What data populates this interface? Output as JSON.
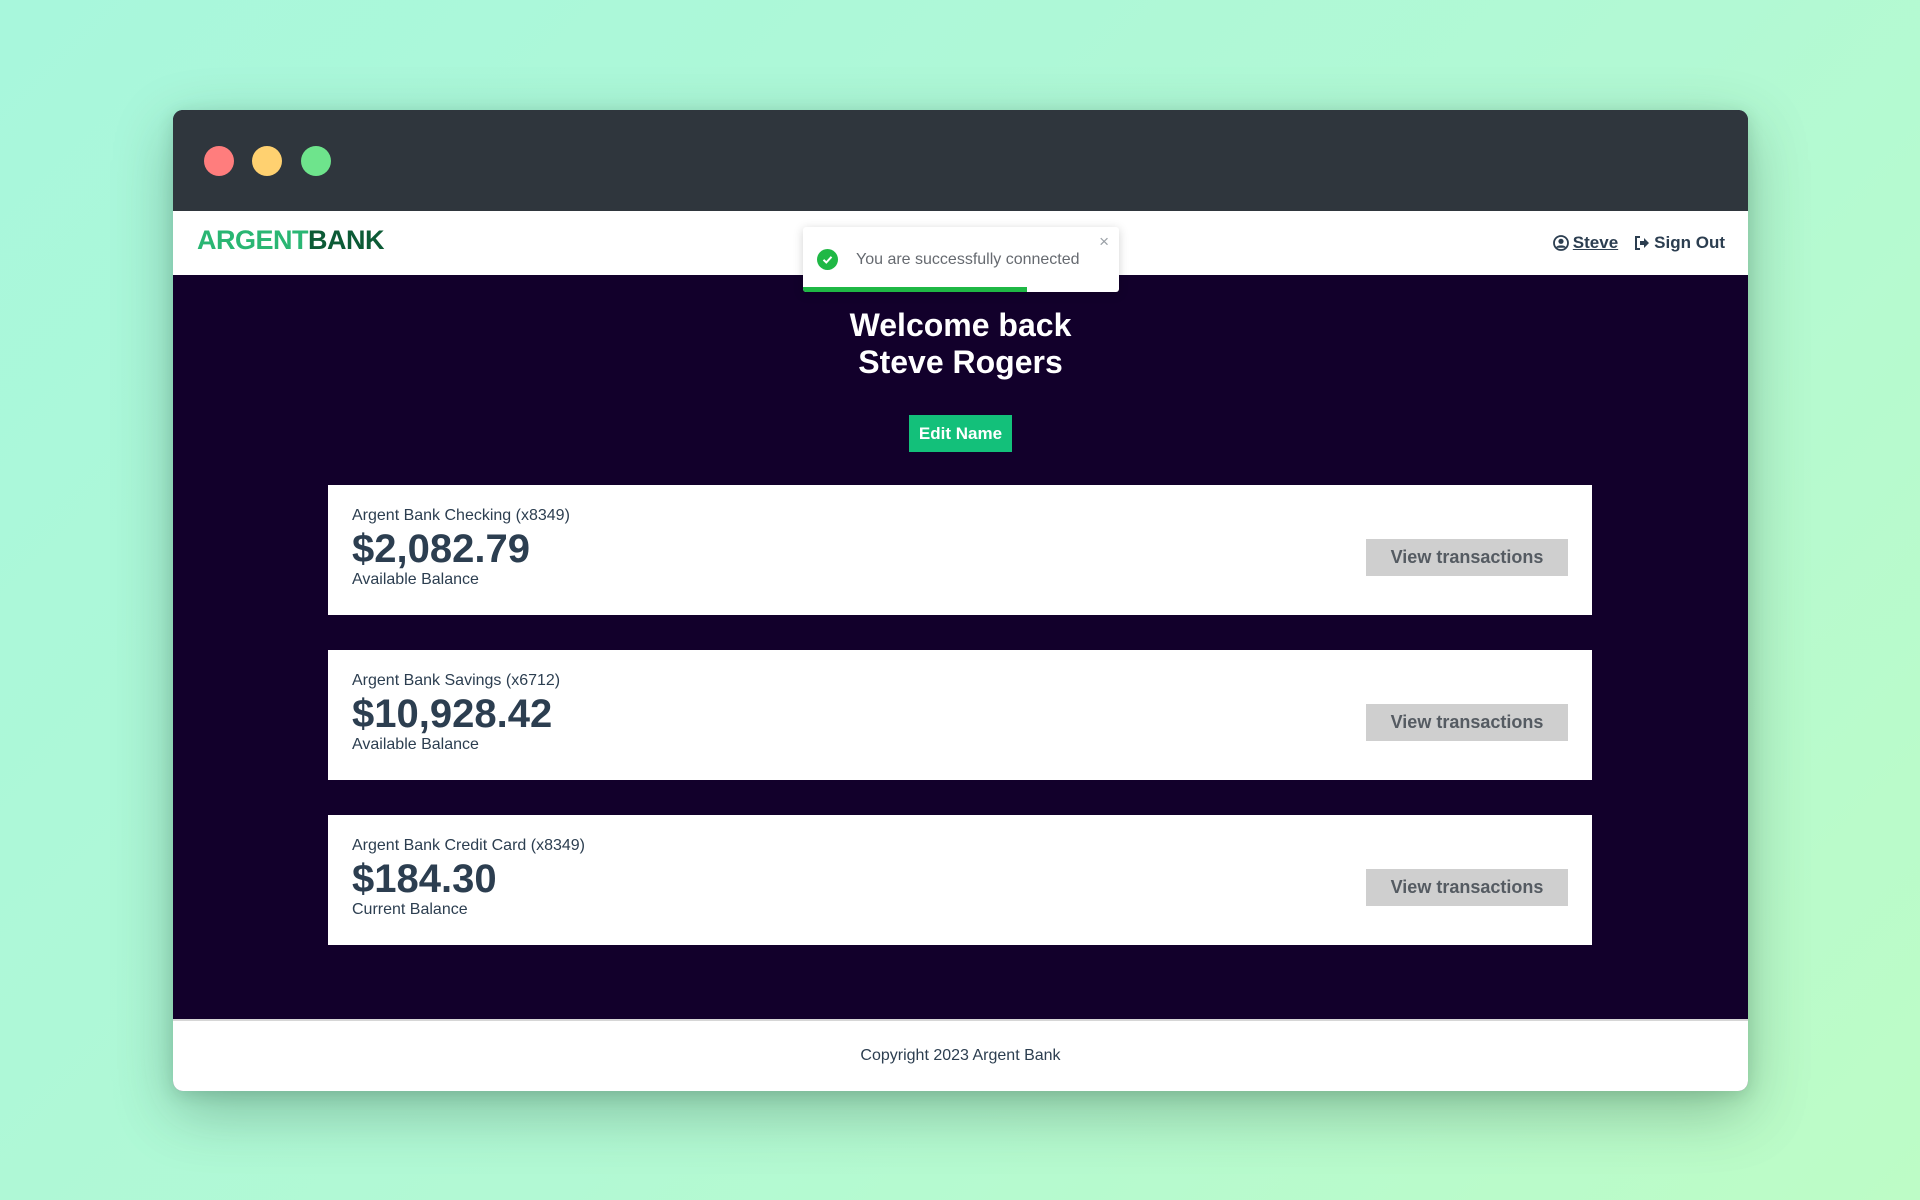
{
  "logo": {
    "part1": "ARGENT",
    "part2": "BANK"
  },
  "nav": {
    "user": "Steve",
    "signout": "Sign Out"
  },
  "toast": {
    "message": "You are successfully connected",
    "close": "×",
    "progress": 0.71,
    "color": "#1fb845"
  },
  "header": {
    "line1": "Welcome back",
    "line2": "Steve Rogers",
    "edit_button": "Edit Name"
  },
  "accounts": [
    {
      "title": "Argent Bank Checking (x8349)",
      "amount": "$2,082.79",
      "description": "Available Balance",
      "button": "View transactions"
    },
    {
      "title": "Argent Bank Savings (x6712)",
      "amount": "$10,928.42",
      "description": "Available Balance",
      "button": "View transactions"
    },
    {
      "title": "Argent Bank Credit Card (x8349)",
      "amount": "$184.30",
      "description": "Current Balance",
      "button": "View transactions"
    }
  ],
  "footer": {
    "text": "Copyright 2023 Argent Bank"
  },
  "colors": {
    "accent": "#13c07a",
    "main_bg": "#12002b",
    "brand_light": "#2ab673",
    "brand_dark": "#0c5b36"
  }
}
